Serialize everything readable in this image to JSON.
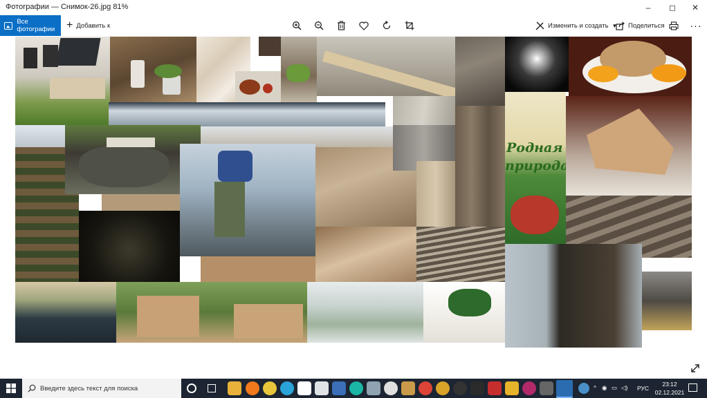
{
  "window": {
    "title": "Фотографии — Снимок-26.jpg   81%",
    "controls": [
      "–",
      "◻",
      "✕"
    ]
  },
  "toolbar": {
    "all_photos_label": "Все фотографии",
    "add_label": "Добавить к",
    "edit_create_label": "Изменить и создать",
    "share_label": "Поделиться",
    "icons": [
      "zoom-in-icon",
      "zoom-out-icon",
      "delete-icon",
      "favorite-icon",
      "rotate-icon",
      "crop-icon",
      "print-icon",
      "more-icon"
    ]
  },
  "taskbar": {
    "search_placeholder": "Введите здесь текст для поиска",
    "language": "РУС",
    "time": "23:12",
    "date": "02.12.2021"
  },
  "colors": {
    "accent": "#0b6fc6",
    "taskbar": "#1c2531"
  },
  "collage_text": {
    "brand_line1": "Родная",
    "brand_line2": "природа"
  }
}
